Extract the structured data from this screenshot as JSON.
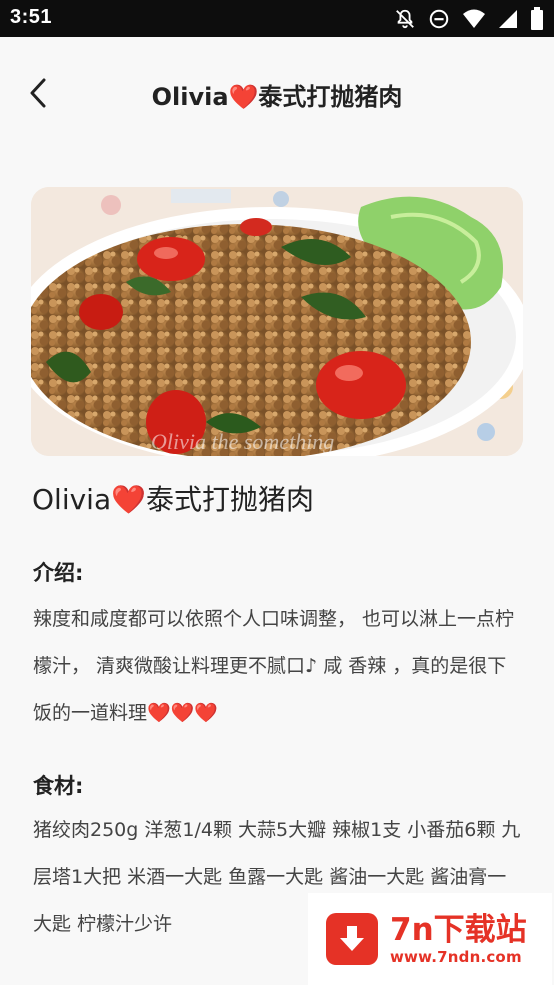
{
  "status_bar": {
    "time": "3:51",
    "icons": [
      "bell-off-icon",
      "do-not-disturb-icon",
      "wifi-icon",
      "signal-icon",
      "battery-icon"
    ]
  },
  "app_bar": {
    "back_icon": "back-arrow-icon",
    "title": "Olivia❤️泰式打抛猪肉"
  },
  "hero_image": {
    "subject": "Thai basil minced pork with tomatoes and lettuce on a white plate",
    "caption_overlay": "Olivia the something"
  },
  "recipe": {
    "name": "Olivia❤️泰式打抛猪肉",
    "intro_heading": "介绍:",
    "intro_text": "辣度和咸度都可以依照个人口味调整， 也可以淋上一点柠檬汁， 清爽微酸让料理更不腻口♪ 咸 香辣 ，真的是很下饭的一道料理❤️❤️❤️",
    "ingredients_heading": "食材:",
    "ingredients_text": "猪绞肉250g 洋葱1/4颗 大蒜5大瓣 辣椒1支 小番茄6颗 九层塔1大把 米酒一大匙 鱼露一大匙 酱油一大匙 酱油膏一大匙 柠檬汁少许"
  },
  "watermark": {
    "name": "7n下载站",
    "url": "www.7ndn.com"
  },
  "colors": {
    "status_bg": "#0d0d0d",
    "page_bg": "#f8f8f8",
    "watermark_red": "#e53226"
  }
}
